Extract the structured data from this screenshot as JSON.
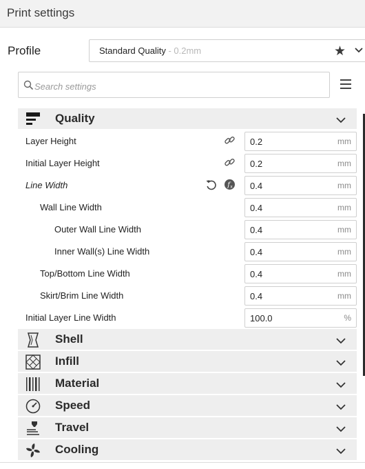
{
  "window": {
    "title": "Print settings"
  },
  "profile": {
    "label": "Profile",
    "name": "Standard Quality",
    "layer": " - 0.2mm",
    "favorite_icon": "star-icon"
  },
  "search": {
    "placeholder": "Search settings"
  },
  "quality": {
    "label": "Quality",
    "rows": [
      {
        "label": "Layer Height",
        "value": "0.2",
        "unit": "mm"
      },
      {
        "label": "Initial Layer Height",
        "value": "0.2",
        "unit": "mm"
      },
      {
        "label": "Line Width",
        "value": "0.4",
        "unit": "mm"
      },
      {
        "label": "Wall Line Width",
        "value": "0.4",
        "unit": "mm"
      },
      {
        "label": "Outer Wall Line Width",
        "value": "0.4",
        "unit": "mm"
      },
      {
        "label": "Inner Wall(s) Line Width",
        "value": "0.4",
        "unit": "mm"
      },
      {
        "label": "Top/Bottom Line Width",
        "value": "0.4",
        "unit": "mm"
      },
      {
        "label": "Skirt/Brim Line Width",
        "value": "0.4",
        "unit": "mm"
      },
      {
        "label": "Initial Layer Line Width",
        "value": "100.0",
        "unit": "%"
      }
    ]
  },
  "categories": [
    {
      "label": "Shell",
      "icon": "shell-icon"
    },
    {
      "label": "Infill",
      "icon": "infill-icon"
    },
    {
      "label": "Material",
      "icon": "material-icon"
    },
    {
      "label": "Speed",
      "icon": "speed-icon"
    },
    {
      "label": "Travel",
      "icon": "travel-icon"
    },
    {
      "label": "Cooling",
      "icon": "cooling-icon"
    }
  ]
}
